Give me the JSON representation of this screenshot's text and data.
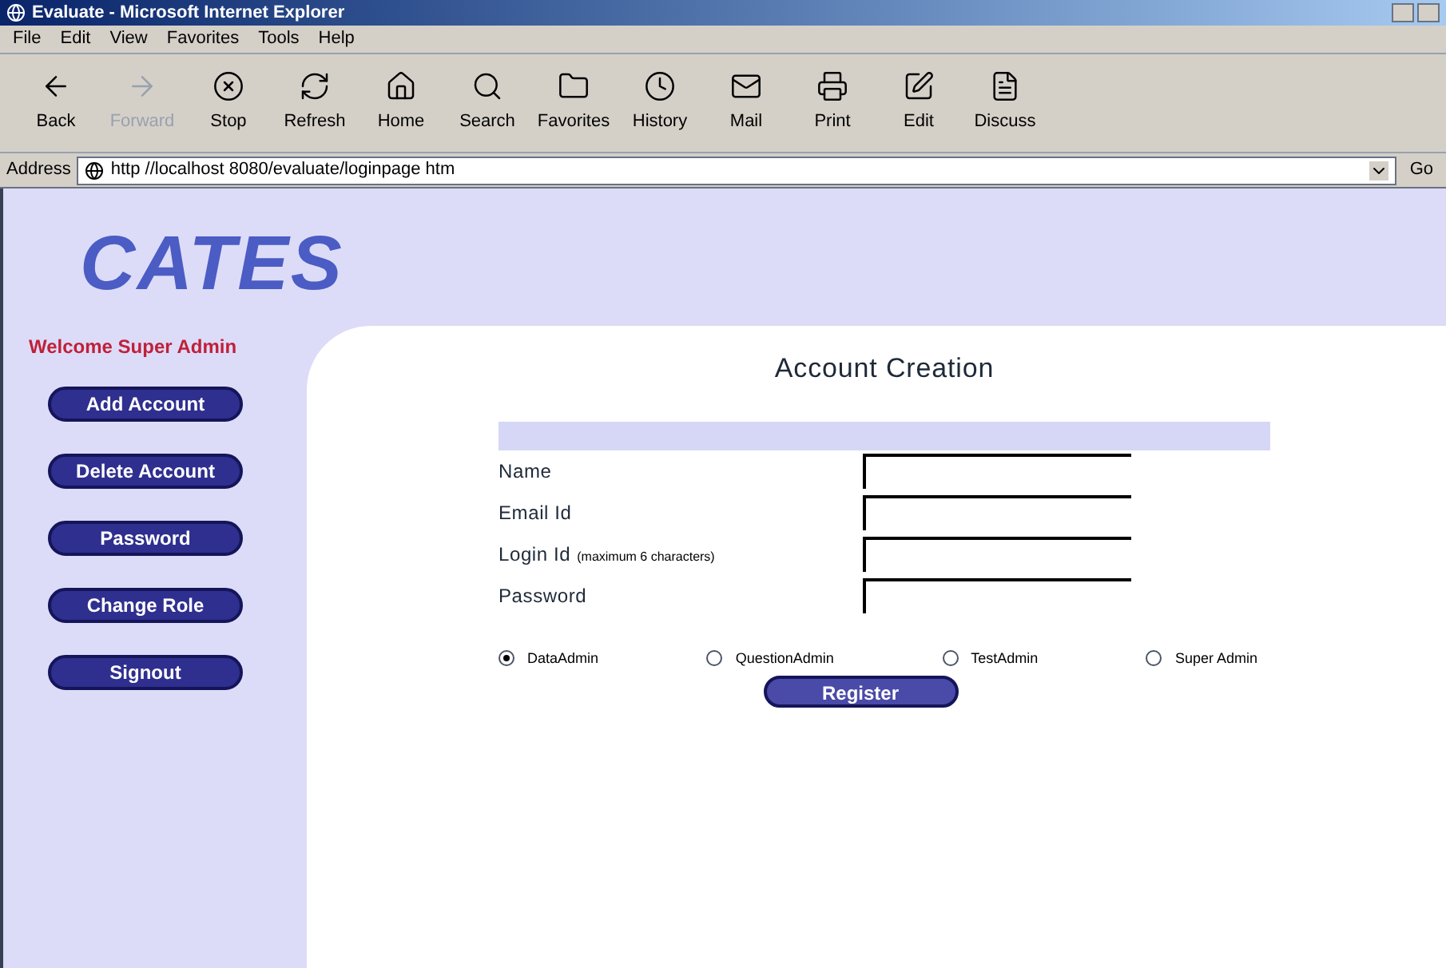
{
  "window": {
    "title": "Evaluate - Microsoft Internet Explorer"
  },
  "menu": [
    "File",
    "Edit",
    "View",
    "Favorites",
    "Tools",
    "Help"
  ],
  "toolbar": [
    {
      "label": "Back",
      "disabled": false
    },
    {
      "label": "Forward",
      "disabled": true
    },
    {
      "label": "Stop",
      "disabled": false
    },
    {
      "label": "Refresh",
      "disabled": false
    },
    {
      "label": "Home",
      "disabled": false
    },
    {
      "label": "Search",
      "disabled": false
    },
    {
      "label": "Favorites",
      "disabled": false
    },
    {
      "label": "History",
      "disabled": false
    },
    {
      "label": "Mail",
      "disabled": false
    },
    {
      "label": "Print",
      "disabled": false
    },
    {
      "label": "Edit",
      "disabled": false
    },
    {
      "label": "Discuss",
      "disabled": false
    }
  ],
  "address": {
    "label": "Address",
    "value": "http //localhost 8080/evaluate/loginpage htm",
    "go": "Go"
  },
  "logo": "CATES",
  "sidebar": {
    "welcome": "Welcome Super Admin",
    "buttons": [
      "Add Account",
      "Delete Account",
      "Password",
      "Change Role",
      "Signout"
    ]
  },
  "form": {
    "title": "Account Creation",
    "fields": [
      {
        "label": "Name"
      },
      {
        "label": "Email Id"
      },
      {
        "label": "Login Id",
        "hint": "(maximum 6 characters)"
      },
      {
        "label": "Password"
      }
    ],
    "roles": [
      {
        "label": "DataAdmin",
        "selected": true
      },
      {
        "label": "QuestionAdmin",
        "selected": false
      },
      {
        "label": "TestAdmin",
        "selected": false
      },
      {
        "label": "Super Admin",
        "selected": false
      }
    ],
    "submit": "Register"
  }
}
